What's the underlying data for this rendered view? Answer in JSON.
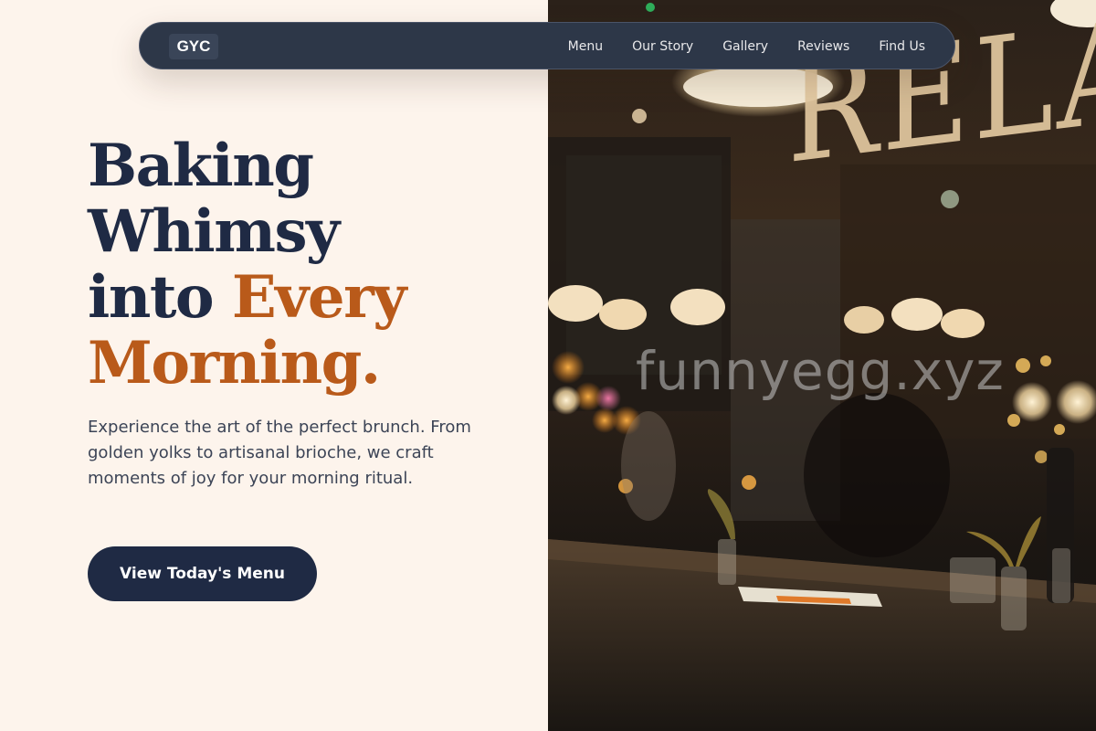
{
  "nav": {
    "logo": "GYC",
    "links": [
      "Menu",
      "Our Story",
      "Gallery",
      "Reviews",
      "Find Us"
    ]
  },
  "hero": {
    "headline_line1": "Baking",
    "headline_line2": "Whimsy",
    "headline_line3_a": "into ",
    "headline_line3_b": "Every",
    "headline_line4": "Morning.",
    "description": "Experience the art of the perfect brunch. From golden yolks to artisanal brioche, we craft moments of joy for your morning ritual.",
    "cta_label": "View Today's Menu"
  },
  "image": {
    "sign_text": "RELAX",
    "watermark": "funnyegg.xyz"
  },
  "colors": {
    "background": "#fdf4ec",
    "navy": "#1f2a44",
    "accent": "#b95a1a",
    "nav_bg": "#2d3748"
  }
}
